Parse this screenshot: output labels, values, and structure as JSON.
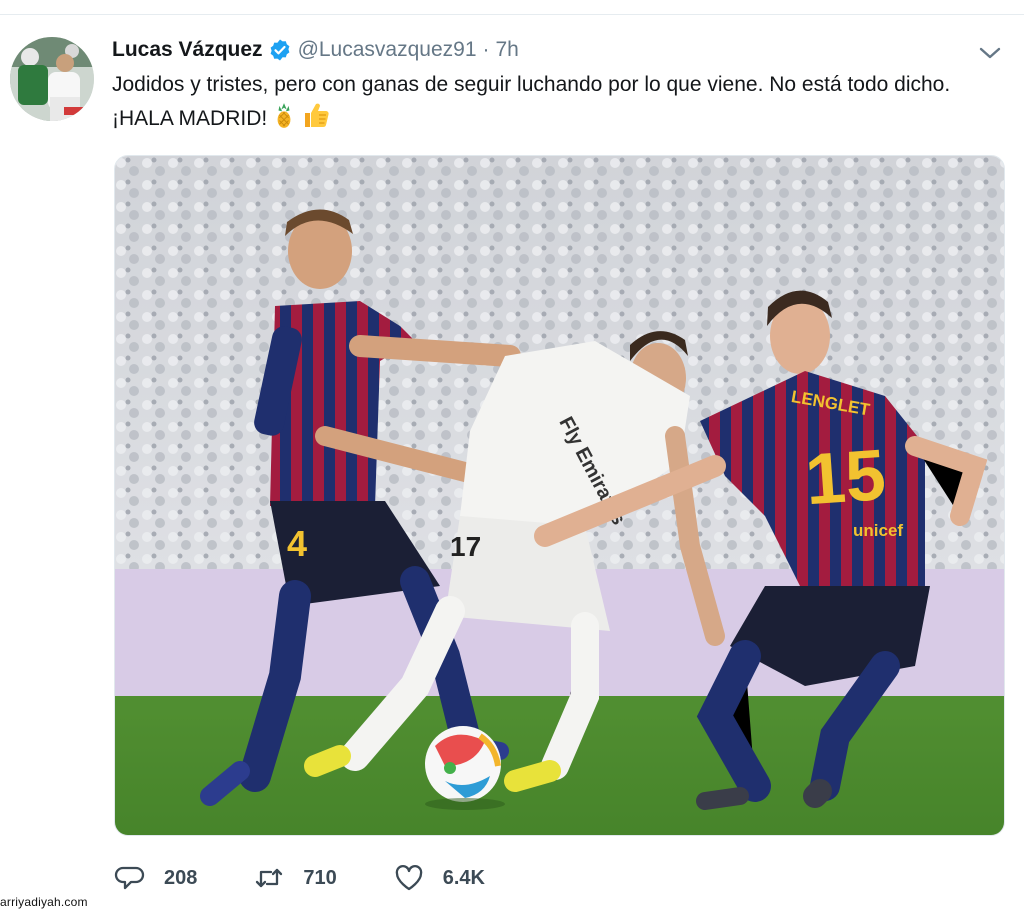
{
  "tweet": {
    "display_name": "Lucas Vázquez",
    "handle": "@Lucasvazquez91",
    "separator": "·",
    "timestamp": "7h",
    "text": "Jodidos y tristes, pero con ganas de seguir luchando por lo que viene. No está todo dicho. ¡HALA MADRID!",
    "emojis": [
      "pineapple-emoji",
      "thumbs-up-emoji"
    ],
    "verified": true
  },
  "media": {
    "player_numbers": [
      "4",
      "17",
      "15"
    ],
    "jersey_names": [
      "LENGLET"
    ],
    "jersey_sponsors": [
      "unicef",
      "Fly Emirates"
    ]
  },
  "actions": {
    "reply_count": "208",
    "retweet_count": "710",
    "like_count": "6.4K"
  },
  "watermark": "arriyadiyah.com",
  "colors": {
    "verified_blue": "#1da1f2",
    "muted_text": "#657786",
    "divider": "#e6ecf0"
  }
}
